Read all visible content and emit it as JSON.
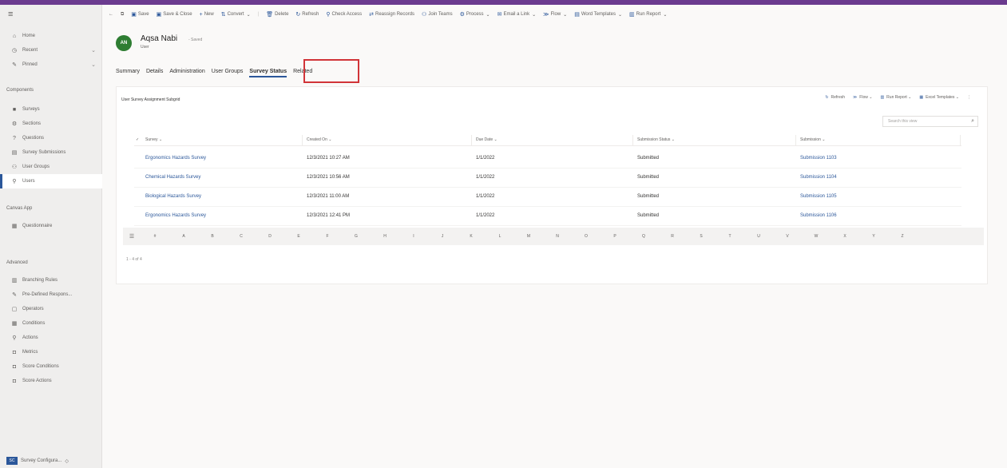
{
  "sidebar": {
    "top": [
      {
        "label": "Home",
        "icon": "home-icon"
      },
      {
        "label": "Recent",
        "icon": "clock-icon",
        "chevron": true
      },
      {
        "label": "Pinned",
        "icon": "pin-icon",
        "chevron": true
      }
    ],
    "components_label": "Components",
    "components": [
      {
        "label": "Surveys",
        "icon": "survey-icon"
      },
      {
        "label": "Sections",
        "icon": "sections-icon"
      },
      {
        "label": "Questions",
        "icon": "question-icon"
      },
      {
        "label": "Survey Submissions",
        "icon": "submissions-icon"
      },
      {
        "label": "User Groups",
        "icon": "groups-icon"
      },
      {
        "label": "Users",
        "icon": "user-icon",
        "active": true
      }
    ],
    "canvas_label": "Canvas App",
    "canvas": [
      {
        "label": "Questionnaire",
        "icon": "app-icon"
      }
    ],
    "advanced_label": "Advanced",
    "advanced": [
      {
        "label": "Branching Rules",
        "icon": "rules-icon"
      },
      {
        "label": "Pre-Defined Respons...",
        "icon": "predefined-icon"
      },
      {
        "label": "Operators",
        "icon": "operators-icon"
      },
      {
        "label": "Conditions",
        "icon": "conditions-icon"
      },
      {
        "label": "Actions",
        "icon": "actions-icon"
      },
      {
        "label": "Metrics",
        "icon": "metrics-icon"
      },
      {
        "label": "Score Conditions",
        "icon": "score-conditions-icon"
      },
      {
        "label": "Score Actions",
        "icon": "score-actions-icon"
      }
    ],
    "app_badge": "SC",
    "app_switcher": "Survey Configura..."
  },
  "commands": [
    {
      "label": "Save",
      "icon": "save-icon"
    },
    {
      "label": "Save & Close",
      "icon": "save-close-icon"
    },
    {
      "label": "New",
      "icon": "plus-icon"
    },
    {
      "label": "Convert",
      "icon": "convert-icon",
      "chevron": true
    },
    {
      "label": "Delete",
      "icon": "delete-icon"
    },
    {
      "label": "Refresh",
      "icon": "refresh-icon"
    },
    {
      "label": "Check Access",
      "icon": "check-access-icon"
    },
    {
      "label": "Reassign Records",
      "icon": "reassign-icon"
    },
    {
      "label": "Join Teams",
      "icon": "join-teams-icon"
    },
    {
      "label": "Process",
      "icon": "process-icon",
      "chevron": true
    },
    {
      "label": "Email a Link",
      "icon": "email-icon",
      "chevron": true
    },
    {
      "label": "Flow",
      "icon": "flow-icon",
      "chevron": true
    },
    {
      "label": "Word Templates",
      "icon": "word-icon",
      "chevron": true
    },
    {
      "label": "Run Report",
      "icon": "report-icon",
      "chevron": true
    }
  ],
  "record": {
    "initials": "AN",
    "name": "Aqsa Nabi",
    "status": "- Saved",
    "type": "User",
    "avatar_color": "#2e7d32"
  },
  "tabs": [
    "Summary",
    "Details",
    "Administration",
    "User Groups",
    "Survey Status",
    "Related"
  ],
  "active_tab": "Survey Status",
  "subgrid": {
    "title": "User Survey Assignment Subgrid",
    "commands": [
      "Refresh",
      "Flow",
      "Run Report",
      "Excel Templates"
    ],
    "search_placeholder": "Search this view",
    "columns": [
      "Survey",
      "Created On",
      "Due Date",
      "Submission Status",
      "Submission"
    ],
    "rows": [
      [
        "Ergonomics Hazards Survey",
        "12/3/2021 10:27 AM",
        "1/1/2022",
        "Submitted",
        "Submission 1103"
      ],
      [
        "Chemical Hazards Survey",
        "12/3/2021 10:56 AM",
        "1/1/2022",
        "Submitted",
        "Submission 1104"
      ],
      [
        "Biological Hazards Survey",
        "12/3/2021 11:00 AM",
        "1/1/2022",
        "Submitted",
        "Submission 1105"
      ],
      [
        "Ergonomics Hazards Survey",
        "12/3/2021 12:41 PM",
        "1/1/2022",
        "Submitted",
        "Submission 1106"
      ]
    ],
    "alphabet": [
      "All",
      "#",
      "A",
      "B",
      "C",
      "D",
      "E",
      "F",
      "G",
      "H",
      "I",
      "J",
      "K",
      "L",
      "M",
      "N",
      "O",
      "P",
      "Q",
      "R",
      "S",
      "T",
      "U",
      "V",
      "W",
      "X",
      "Y",
      "Z"
    ],
    "count": "1 - 4 of 4"
  },
  "accent": "#2b579a",
  "highlight_color": "#d13438"
}
